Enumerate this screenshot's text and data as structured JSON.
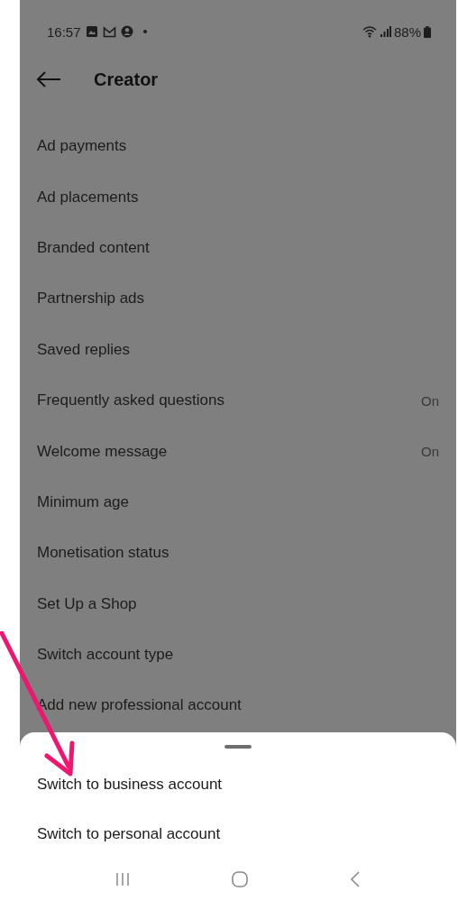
{
  "status_bar": {
    "time": "16:57",
    "battery": "88%"
  },
  "header": {
    "title": "Creator"
  },
  "items": [
    {
      "label": "Ad payments"
    },
    {
      "label": "Ad placements"
    },
    {
      "label": "Branded content"
    },
    {
      "label": "Partnership ads"
    },
    {
      "label": "Saved replies"
    },
    {
      "label": "Frequently asked questions",
      "value": "On"
    },
    {
      "label": "Welcome message",
      "value": "On"
    },
    {
      "label": "Minimum age"
    },
    {
      "label": "Monetisation status"
    },
    {
      "label": "Set Up a Shop"
    },
    {
      "label": "Switch account type"
    },
    {
      "label": "Add new professional account"
    }
  ],
  "sheet": {
    "options": [
      "Switch to business account",
      "Switch to personal account"
    ]
  }
}
